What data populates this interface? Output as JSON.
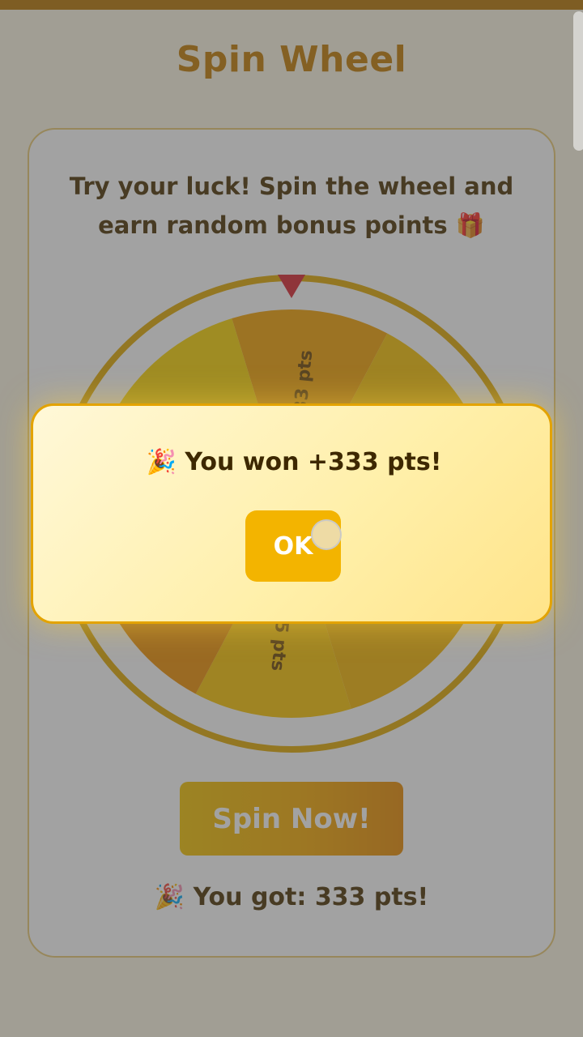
{
  "header": {
    "title": "Spin Wheel"
  },
  "card": {
    "intro": "Try your luck! Spin the wheel and earn random bonus points 🎁"
  },
  "wheel": {
    "segments": [
      {
        "label": "333 pts",
        "color": "#f3a000"
      },
      {
        "label": "",
        "color": "#f7c000"
      },
      {
        "label": "",
        "color": "#f29a00"
      },
      {
        "label": "",
        "color": "#f5b400"
      },
      {
        "label": "55 pts",
        "color": "#f8c200"
      },
      {
        "label": "",
        "color": "#ee8f00"
      },
      {
        "label": "",
        "color": "#f6b600"
      },
      {
        "label": "",
        "color": "#f9d200"
      }
    ],
    "pointer_color": "#d9252f",
    "rim_color": "#e0a800"
  },
  "spin": {
    "label": "Spin Now!"
  },
  "result": {
    "text": "🎉 You got: 333 pts!"
  },
  "modal": {
    "message": "🎉 You won +333 pts!",
    "ok_label": "OK"
  }
}
